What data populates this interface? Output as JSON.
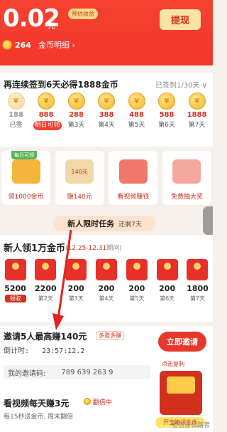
{
  "balance": {
    "value": "0.02",
    "unit": "元",
    "est_tag": "预估收益",
    "coins": "264",
    "coins_link": "金币明细 ›",
    "withdraw": "提现"
  },
  "checkin": {
    "title": "再连续签到6天必得1888金币",
    "progress": "已签到1/30天 ∨",
    "days": [
      {
        "amount": "188",
        "label": "已签",
        "state": "done"
      },
      {
        "amount": "888",
        "label": "明日可领",
        "state": "next"
      },
      {
        "amount": "288",
        "label": "第3天",
        "state": "normal"
      },
      {
        "amount": "388",
        "label": "第4天",
        "state": "normal"
      },
      {
        "amount": "488",
        "label": "第5天",
        "state": "normal"
      },
      {
        "amount": "588",
        "label": "第6天",
        "state": "normal"
      },
      {
        "amount": "1888",
        "label": "第7天",
        "state": "normal"
      }
    ]
  },
  "tasks": [
    {
      "badge": "每日可领",
      "label": "领1000金币"
    },
    {
      "badge": "",
      "label": "赚140元",
      "icon_text": "140元"
    },
    {
      "badge": "",
      "label": "看视频赚钱"
    },
    {
      "badge": "",
      "label": "免费抽大奖"
    }
  ],
  "new_user_banner": {
    "title": "新人限时任务",
    "subtitle": "还剩7天"
  },
  "new_user": {
    "title": "新人领1万金币",
    "period_prefix": "(",
    "period_dates": "12.25-12.31",
    "period_suffix": "期间)",
    "rewards": [
      {
        "amount": "5200",
        "label": "领取"
      },
      {
        "amount": "2200",
        "label": "第2天"
      },
      {
        "amount": "200",
        "label": "第3天"
      },
      {
        "amount": "200",
        "label": "第4天"
      },
      {
        "amount": "200",
        "label": "第5天"
      },
      {
        "amount": "200",
        "label": "第6天"
      },
      {
        "amount": "1800",
        "label": "第7天"
      }
    ]
  },
  "invite": {
    "title": "邀请5人最高赚140元",
    "tag": "多邀多赚",
    "countdown_label": "倒计时:",
    "countdown": "23:57:12.2",
    "button": "立即邀请",
    "code_label": "我的邀请码:",
    "code": "789 639 263 9",
    "chest_top": "点击复制",
    "chest_label": "开宝箱领金币"
  },
  "video": {
    "title": "看视频每天赚3元",
    "tag": "翻倍中",
    "desc": "每15秒送金币, 周末翻倍",
    "watermark": "老创业领路者"
  }
}
